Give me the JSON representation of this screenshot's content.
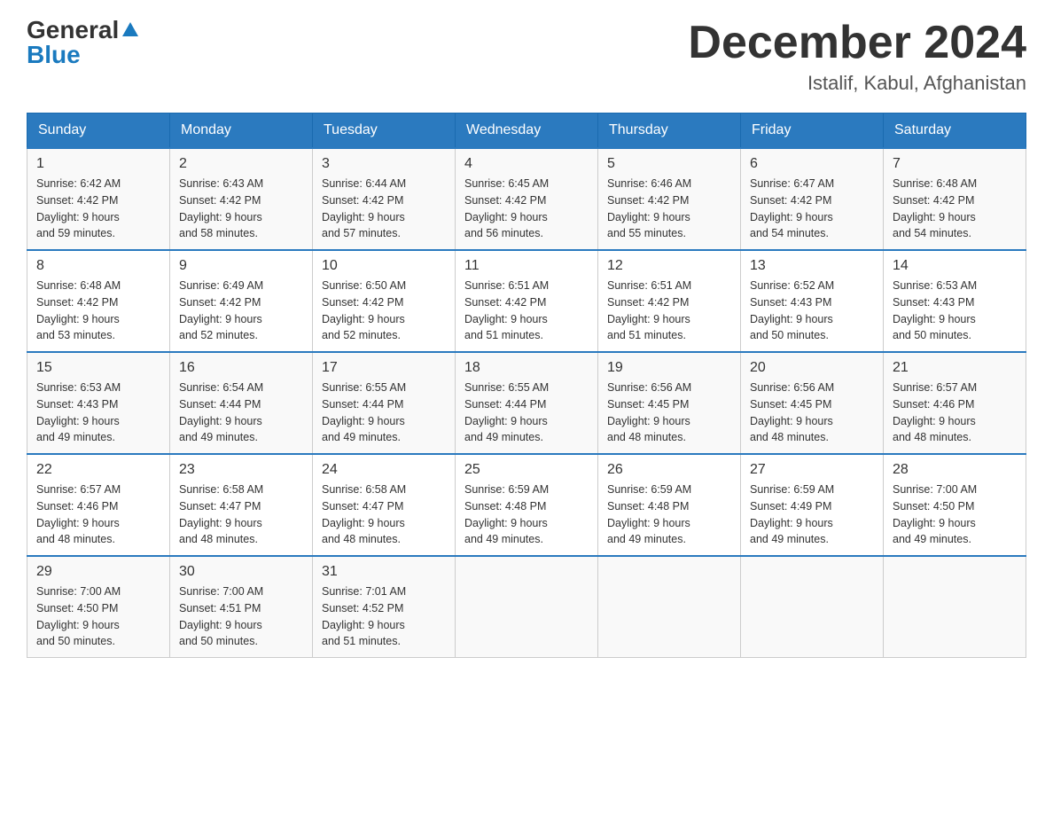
{
  "header": {
    "logo_general": "General",
    "logo_blue": "Blue",
    "title": "December 2024",
    "subtitle": "Istalif, Kabul, Afghanistan"
  },
  "days_of_week": [
    "Sunday",
    "Monday",
    "Tuesday",
    "Wednesday",
    "Thursday",
    "Friday",
    "Saturday"
  ],
  "weeks": [
    [
      {
        "day": "1",
        "sunrise": "6:42 AM",
        "sunset": "4:42 PM",
        "daylight": "9 hours and 59 minutes."
      },
      {
        "day": "2",
        "sunrise": "6:43 AM",
        "sunset": "4:42 PM",
        "daylight": "9 hours and 58 minutes."
      },
      {
        "day": "3",
        "sunrise": "6:44 AM",
        "sunset": "4:42 PM",
        "daylight": "9 hours and 57 minutes."
      },
      {
        "day": "4",
        "sunrise": "6:45 AM",
        "sunset": "4:42 PM",
        "daylight": "9 hours and 56 minutes."
      },
      {
        "day": "5",
        "sunrise": "6:46 AM",
        "sunset": "4:42 PM",
        "daylight": "9 hours and 55 minutes."
      },
      {
        "day": "6",
        "sunrise": "6:47 AM",
        "sunset": "4:42 PM",
        "daylight": "9 hours and 54 minutes."
      },
      {
        "day": "7",
        "sunrise": "6:48 AM",
        "sunset": "4:42 PM",
        "daylight": "9 hours and 54 minutes."
      }
    ],
    [
      {
        "day": "8",
        "sunrise": "6:48 AM",
        "sunset": "4:42 PM",
        "daylight": "9 hours and 53 minutes."
      },
      {
        "day": "9",
        "sunrise": "6:49 AM",
        "sunset": "4:42 PM",
        "daylight": "9 hours and 52 minutes."
      },
      {
        "day": "10",
        "sunrise": "6:50 AM",
        "sunset": "4:42 PM",
        "daylight": "9 hours and 52 minutes."
      },
      {
        "day": "11",
        "sunrise": "6:51 AM",
        "sunset": "4:42 PM",
        "daylight": "9 hours and 51 minutes."
      },
      {
        "day": "12",
        "sunrise": "6:51 AM",
        "sunset": "4:42 PM",
        "daylight": "9 hours and 51 minutes."
      },
      {
        "day": "13",
        "sunrise": "6:52 AM",
        "sunset": "4:43 PM",
        "daylight": "9 hours and 50 minutes."
      },
      {
        "day": "14",
        "sunrise": "6:53 AM",
        "sunset": "4:43 PM",
        "daylight": "9 hours and 50 minutes."
      }
    ],
    [
      {
        "day": "15",
        "sunrise": "6:53 AM",
        "sunset": "4:43 PM",
        "daylight": "9 hours and 49 minutes."
      },
      {
        "day": "16",
        "sunrise": "6:54 AM",
        "sunset": "4:44 PM",
        "daylight": "9 hours and 49 minutes."
      },
      {
        "day": "17",
        "sunrise": "6:55 AM",
        "sunset": "4:44 PM",
        "daylight": "9 hours and 49 minutes."
      },
      {
        "day": "18",
        "sunrise": "6:55 AM",
        "sunset": "4:44 PM",
        "daylight": "9 hours and 49 minutes."
      },
      {
        "day": "19",
        "sunrise": "6:56 AM",
        "sunset": "4:45 PM",
        "daylight": "9 hours and 48 minutes."
      },
      {
        "day": "20",
        "sunrise": "6:56 AM",
        "sunset": "4:45 PM",
        "daylight": "9 hours and 48 minutes."
      },
      {
        "day": "21",
        "sunrise": "6:57 AM",
        "sunset": "4:46 PM",
        "daylight": "9 hours and 48 minutes."
      }
    ],
    [
      {
        "day": "22",
        "sunrise": "6:57 AM",
        "sunset": "4:46 PM",
        "daylight": "9 hours and 48 minutes."
      },
      {
        "day": "23",
        "sunrise": "6:58 AM",
        "sunset": "4:47 PM",
        "daylight": "9 hours and 48 minutes."
      },
      {
        "day": "24",
        "sunrise": "6:58 AM",
        "sunset": "4:47 PM",
        "daylight": "9 hours and 48 minutes."
      },
      {
        "day": "25",
        "sunrise": "6:59 AM",
        "sunset": "4:48 PM",
        "daylight": "9 hours and 49 minutes."
      },
      {
        "day": "26",
        "sunrise": "6:59 AM",
        "sunset": "4:48 PM",
        "daylight": "9 hours and 49 minutes."
      },
      {
        "day": "27",
        "sunrise": "6:59 AM",
        "sunset": "4:49 PM",
        "daylight": "9 hours and 49 minutes."
      },
      {
        "day": "28",
        "sunrise": "7:00 AM",
        "sunset": "4:50 PM",
        "daylight": "9 hours and 49 minutes."
      }
    ],
    [
      {
        "day": "29",
        "sunrise": "7:00 AM",
        "sunset": "4:50 PM",
        "daylight": "9 hours and 50 minutes."
      },
      {
        "day": "30",
        "sunrise": "7:00 AM",
        "sunset": "4:51 PM",
        "daylight": "9 hours and 50 minutes."
      },
      {
        "day": "31",
        "sunrise": "7:01 AM",
        "sunset": "4:52 PM",
        "daylight": "9 hours and 51 minutes."
      },
      null,
      null,
      null,
      null
    ]
  ],
  "labels": {
    "sunrise": "Sunrise:",
    "sunset": "Sunset:",
    "daylight": "Daylight:"
  }
}
